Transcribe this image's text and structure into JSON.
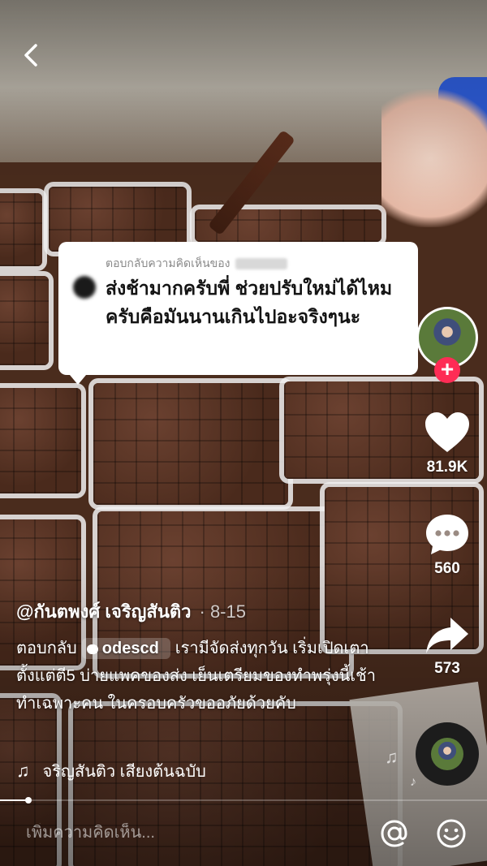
{
  "reply": {
    "header": "ตอบกลับความคิดเห็นของ",
    "text": "ส่งช้ามากครับพี่ ช่วยปรับใหม่ได้ไหมครับคือมันนานเกินไปอะจริงๆนะ"
  },
  "actions": {
    "likes": "81.9K",
    "comments": "560",
    "shares": "573"
  },
  "post": {
    "author": "@กันตพงศ์ เจริญสันติว",
    "date": "· 8-15",
    "reply_prefix": "ตอบกลับ",
    "mention": "odescd",
    "caption": "เรามีจัดส่งทุกวัน เริ่มเปิดเตาตั้งแต่ตี5 บ่ายแพคของส่ง เย็นเตรียมของทำพรุ่งนี้เช้า ทำเฉพาะคน ในครอบครัวขออภัยด้วยคับ"
  },
  "music": {
    "label": "จริญสันติว เสียงต้นฉบับ"
  },
  "comment_bar": {
    "placeholder": "เพิ่มความคิดเห็น..."
  },
  "progress": {
    "value": 0.06
  },
  "colors": {
    "follow": "#fe2c55",
    "sleeve": "#2d5bd6"
  }
}
